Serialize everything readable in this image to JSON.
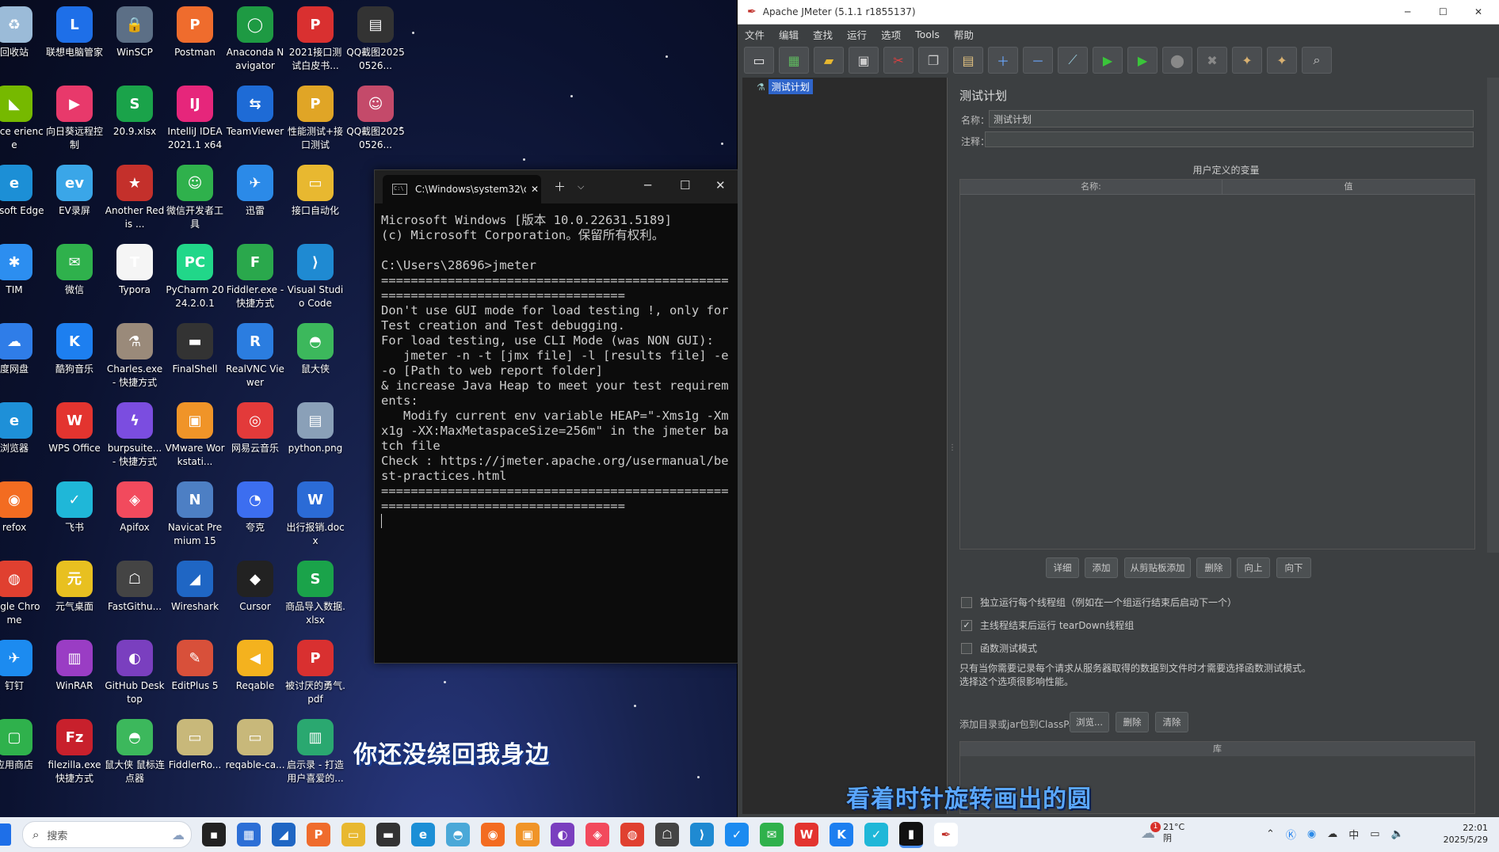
{
  "desktop": {
    "icons": [
      {
        "label": "回收站",
        "glyph": "♻",
        "color": "#9bbbd8",
        "col": 0,
        "row": 0
      },
      {
        "label": "联想电脑管家",
        "glyph": "L",
        "color": "#1e6fe8",
        "col": 1,
        "row": 0
      },
      {
        "label": "WinSCP",
        "glyph": "🔒",
        "color": "#5c6f86",
        "col": 2,
        "row": 0
      },
      {
        "label": "Postman",
        "glyph": "P",
        "color": "#ef6c2d",
        "col": 3,
        "row": 0
      },
      {
        "label": "Anaconda Navigator",
        "glyph": "◯",
        "color": "#1e9a43",
        "col": 4,
        "row": 0
      },
      {
        "label": "2021接口测试白皮书...",
        "glyph": "P",
        "color": "#d93030",
        "col": 5,
        "row": 0
      },
      {
        "label": "QQ截图20250526...",
        "glyph": "▤",
        "color": "#333",
        "col": 6,
        "row": 0
      },
      {
        "label": "Force erience",
        "glyph": "◣",
        "color": "#76b900",
        "col": 0,
        "row": 1
      },
      {
        "label": "向日葵远程控制",
        "glyph": "▶",
        "color": "#e8396b",
        "col": 1,
        "row": 1
      },
      {
        "label": "20.9.xlsx",
        "glyph": "S",
        "color": "#1aa34a",
        "col": 2,
        "row": 1
      },
      {
        "label": "IntelliJ IDEA 2021.1 x64",
        "glyph": "IJ",
        "color": "#e6267b",
        "col": 3,
        "row": 1
      },
      {
        "label": "TeamViewer",
        "glyph": "⇆",
        "color": "#1e6bd6",
        "col": 4,
        "row": 1
      },
      {
        "label": "性能测试+接口测试",
        "glyph": "P",
        "color": "#e0a526",
        "col": 5,
        "row": 1
      },
      {
        "label": "QQ截图20250526...",
        "glyph": "☺",
        "color": "#c44a6a",
        "col": 6,
        "row": 1
      },
      {
        "label": "crosoft Edge",
        "glyph": "e",
        "color": "#1c8fd6",
        "col": 0,
        "row": 2
      },
      {
        "label": "EV录屏",
        "glyph": "ev",
        "color": "#3aa6e8",
        "col": 1,
        "row": 2
      },
      {
        "label": "Another Redis ...",
        "glyph": "★",
        "color": "#c4302b",
        "col": 2,
        "row": 2
      },
      {
        "label": "微信开发者工具",
        "glyph": "☺",
        "color": "#2fb14c",
        "col": 3,
        "row": 2
      },
      {
        "label": "迅雷",
        "glyph": "✈",
        "color": "#2b8ae8",
        "col": 4,
        "row": 2
      },
      {
        "label": "接口自动化",
        "glyph": "▭",
        "color": "#e8b830",
        "col": 5,
        "row": 2
      },
      {
        "label": "TIM",
        "glyph": "✱",
        "color": "#2c8ef0",
        "col": 0,
        "row": 3
      },
      {
        "label": "微信",
        "glyph": "✉",
        "color": "#2fb14c",
        "col": 1,
        "row": 3
      },
      {
        "label": "Typora",
        "glyph": "T",
        "color": "#f5f5f5",
        "col": 2,
        "row": 3
      },
      {
        "label": "PyCharm 2024.2.0.1",
        "glyph": "PC",
        "color": "#21d789",
        "col": 3,
        "row": 3
      },
      {
        "label": "Fiddler.exe - 快捷方式",
        "glyph": "F",
        "color": "#2aa84c",
        "col": 4,
        "row": 3
      },
      {
        "label": "Visual Studio Code",
        "glyph": "⟩",
        "color": "#1f8ad2",
        "col": 5,
        "row": 3
      },
      {
        "label": "度网盘",
        "glyph": "☁",
        "color": "#2f7de8",
        "col": 0,
        "row": 4
      },
      {
        "label": "酷狗音乐",
        "glyph": "K",
        "color": "#1d7ff0",
        "col": 1,
        "row": 4
      },
      {
        "label": "Charles.exe - 快捷方式",
        "glyph": "⚗",
        "color": "#9a8a7a",
        "col": 2,
        "row": 4
      },
      {
        "label": "FinalShell",
        "glyph": "▬",
        "color": "#333",
        "col": 3,
        "row": 4
      },
      {
        "label": "RealVNC Viewer",
        "glyph": "R",
        "color": "#2b7de0",
        "col": 4,
        "row": 4
      },
      {
        "label": "鼠大侠",
        "glyph": "◓",
        "color": "#3cb85c",
        "col": 5,
        "row": 4
      },
      {
        "label": "浏览器",
        "glyph": "e",
        "color": "#1e90d8",
        "col": 0,
        "row": 5
      },
      {
        "label": "WPS Office",
        "glyph": "W",
        "color": "#e3342f",
        "col": 1,
        "row": 5
      },
      {
        "label": "burpsuite... - 快捷方式",
        "glyph": "ϟ",
        "color": "#7b4de0",
        "col": 2,
        "row": 5
      },
      {
        "label": "VMware Workstati...",
        "glyph": "▣",
        "color": "#f09428",
        "col": 3,
        "row": 5
      },
      {
        "label": "网易云音乐",
        "glyph": "◎",
        "color": "#e33a3a",
        "col": 4,
        "row": 5
      },
      {
        "label": "python.png",
        "glyph": "▤",
        "color": "#8aa0b8",
        "col": 5,
        "row": 5
      },
      {
        "label": "refox",
        "glyph": "◉",
        "color": "#f36c21",
        "col": 0,
        "row": 6
      },
      {
        "label": "飞书",
        "glyph": "✓",
        "color": "#1fb7d8",
        "col": 1,
        "row": 6
      },
      {
        "label": "Apifox",
        "glyph": "◈",
        "color": "#f24a5d",
        "col": 2,
        "row": 6
      },
      {
        "label": "Navicat Premium 15",
        "glyph": "N",
        "color": "#4d7fc4",
        "col": 3,
        "row": 6
      },
      {
        "label": "夸克",
        "glyph": "◔",
        "color": "#3c6ef0",
        "col": 4,
        "row": 6
      },
      {
        "label": "出行报销.docx",
        "glyph": "W",
        "color": "#2b6bd6",
        "col": 5,
        "row": 6
      },
      {
        "label": "oogle Chrome",
        "glyph": "◍",
        "color": "#e04030",
        "col": 0,
        "row": 7
      },
      {
        "label": "元气桌面",
        "glyph": "元",
        "color": "#e8c020",
        "col": 1,
        "row": 7
      },
      {
        "label": "FastGithu...",
        "glyph": "☖",
        "color": "#444",
        "col": 2,
        "row": 7
      },
      {
        "label": "Wireshark",
        "glyph": "◢",
        "color": "#1f66c4",
        "col": 3,
        "row": 7
      },
      {
        "label": "Cursor",
        "glyph": "◆",
        "color": "#222",
        "col": 4,
        "row": 7
      },
      {
        "label": "商品导入数据.xlsx",
        "glyph": "S",
        "color": "#1aa34a",
        "col": 5,
        "row": 7
      },
      {
        "label": "钉钉",
        "glyph": "✈",
        "color": "#1c8bf0",
        "col": 0,
        "row": 8
      },
      {
        "label": "WinRAR",
        "glyph": "▥",
        "color": "#9a3dc4",
        "col": 1,
        "row": 8
      },
      {
        "label": "GitHub Desktop",
        "glyph": "◐",
        "color": "#7a3fbf",
        "col": 2,
        "row": 8
      },
      {
        "label": "EditPlus 5",
        "glyph": "✎",
        "color": "#d8503a",
        "col": 3,
        "row": 8
      },
      {
        "label": "Reqable",
        "glyph": "◀",
        "color": "#f4b21e",
        "col": 4,
        "row": 8
      },
      {
        "label": "被讨厌的勇气.pdf",
        "glyph": "P",
        "color": "#d93030",
        "col": 5,
        "row": 8
      },
      {
        "label": "应用商店",
        "glyph": "▢",
        "color": "#2fb14c",
        "col": 0,
        "row": 9
      },
      {
        "label": "filezilla.exe 快捷方式",
        "glyph": "Fz",
        "color": "#c8202c",
        "col": 1,
        "row": 9
      },
      {
        "label": "鼠大侠 鼠标连点器",
        "glyph": "◓",
        "color": "#3cb85c",
        "col": 2,
        "row": 9
      },
      {
        "label": "FiddlerRo...",
        "glyph": "▭",
        "color": "#c8b87a",
        "col": 3,
        "row": 9
      },
      {
        "label": "reqable-ca...",
        "glyph": "▭",
        "color": "#c8b87a",
        "col": 4,
        "row": 9
      },
      {
        "label": "启示录 - 打造用户喜爱的...",
        "glyph": "▥",
        "color": "#2aa870",
        "col": 5,
        "row": 9
      }
    ],
    "lyric1": "你还没绕回我身边",
    "lyric2": "看着时针旋转画出的圆"
  },
  "terminal": {
    "tab_title": "C:\\Windows\\system32\\c",
    "output": "Microsoft Windows [版本 10.0.22631.5189]\n(c) Microsoft Corporation。保留所有权利。\n\nC:\\Users\\28696>jmeter\n================================================================================\nDon't use GUI mode for load testing !, only for Test creation and Test debugging.\nFor load testing, use CLI Mode (was NON GUI):\n   jmeter -n -t [jmx file] -l [results file] -e -o [Path to web report folder]\n& increase Java Heap to meet your test requirements:\n   Modify current env variable HEAP=\"-Xms1g -Xmx1g -XX:MaxMetaspaceSize=256m\" in the jmeter batch file\nCheck : https://jmeter.apache.org/usermanual/best-practices.html\n================================================================================\n"
  },
  "jmeter": {
    "title": "Apache JMeter (5.1.1 r1855137)",
    "menu": [
      "文件",
      "编辑",
      "查找",
      "运行",
      "选项",
      "Tools",
      "帮助"
    ],
    "tree_item": "测试计划",
    "panel_title": "测试计划",
    "name_label": "名称：",
    "name_value": "测试计划",
    "comment_label": "注释：",
    "comment_value": "",
    "vars_title": "用户定义的变量",
    "col_name": "名称:",
    "col_value": "值",
    "buttons": {
      "detail": "详细",
      "add": "添加",
      "add_clip": "从剪贴板添加",
      "delete": "删除",
      "up": "向上",
      "down": "向下"
    },
    "check1": "独立运行每个线程组（例如在一个组运行结束后启动下一个）",
    "check2": "主线程结束后运行 tearDown线程组",
    "check3": "函数测试模式",
    "note1": "只有当你需要记录每个请求从服务器取得的数据到文件时才需要选择函数测试模式。",
    "note2": "选择这个选项很影响性能。",
    "classpath_label": "添加目录或jar包到ClassPath",
    "cp_browse": "浏览...",
    "cp_delete": "删除",
    "cp_clear": "清除",
    "lib_header": "库"
  },
  "taskbar": {
    "search_placeholder": "搜索",
    "weather_temp": "21°C",
    "weather_desc": "阴",
    "weather_badge": "1",
    "ime": "中",
    "time": "22:01",
    "date": "2025/5/29"
  }
}
